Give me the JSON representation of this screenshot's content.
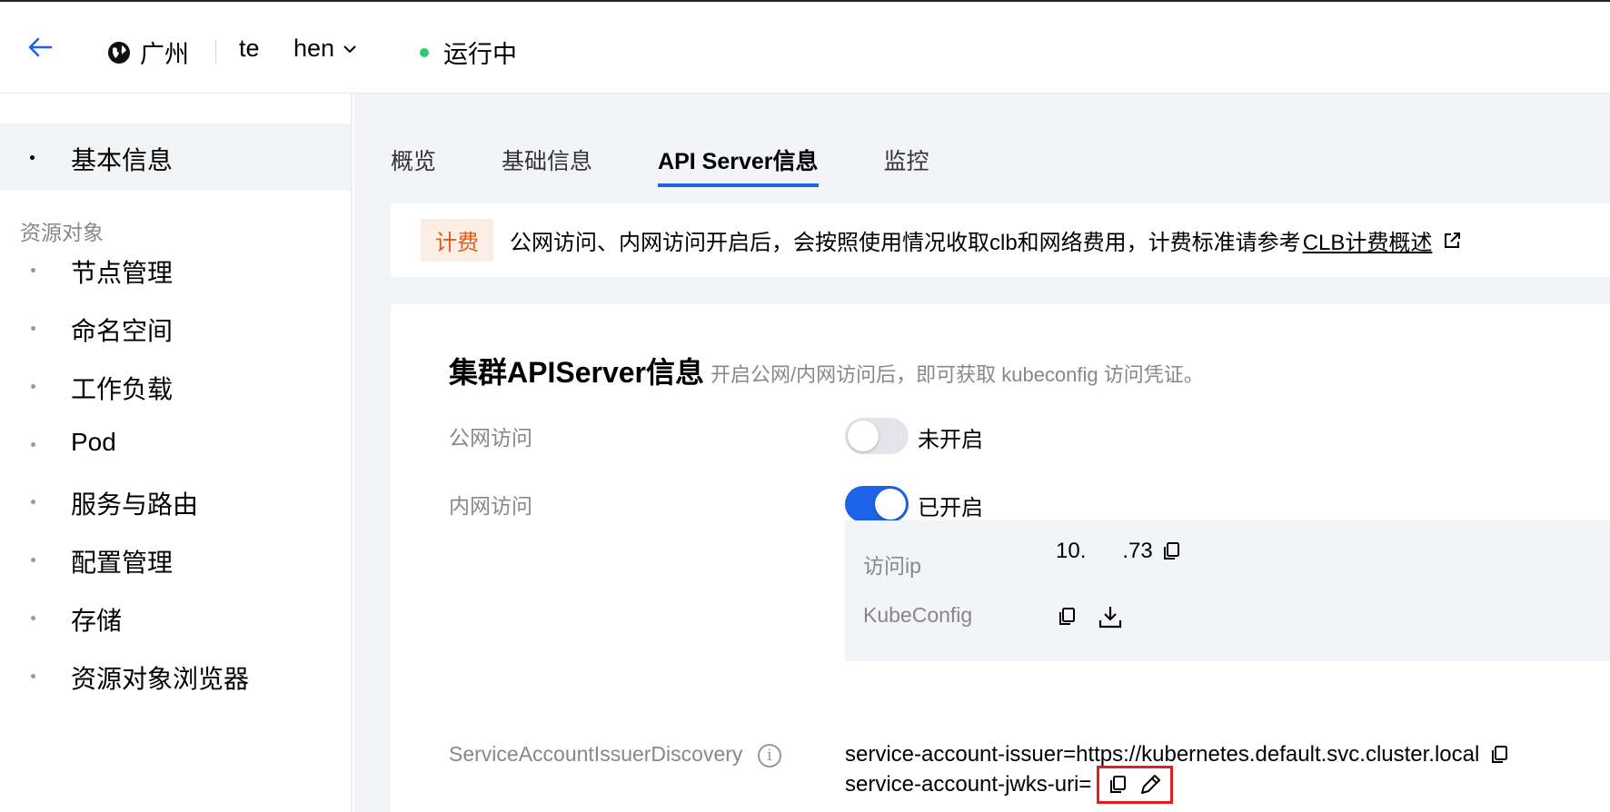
{
  "header": {
    "region": "广州",
    "cluster_name": "te     hen",
    "status": "运行中",
    "status_color": "#29cc6a"
  },
  "sidebar": {
    "active_item": "基本信息",
    "group_label": "资源对象",
    "items": [
      {
        "label": "节点管理"
      },
      {
        "label": "命名空间"
      },
      {
        "label": "工作负载"
      },
      {
        "label": "Pod"
      },
      {
        "label": "服务与路由"
      },
      {
        "label": "配置管理"
      },
      {
        "label": "存储"
      },
      {
        "label": "资源对象浏览器"
      }
    ]
  },
  "tabs": [
    {
      "label": "概览"
    },
    {
      "label": "基础信息"
    },
    {
      "label": "API Server信息",
      "active": true
    },
    {
      "label": "监控"
    }
  ],
  "notice": {
    "badge": "计费",
    "text": "公网访问、内网访问开启后，会按照使用情况收取clb和网络费用，计费标准请参考",
    "link": "CLB计费概述"
  },
  "card": {
    "title": "集群APIServer信息",
    "subtitle": "开启公网/内网访问后，即可获取 kubeconfig 访问凭证。",
    "public_access": {
      "label": "公网访问",
      "enabled": false,
      "state_text": "未开启"
    },
    "private_access": {
      "label": "内网访问",
      "enabled": true,
      "state_text": "已开启"
    },
    "access_ip": {
      "label": "访问ip",
      "value": "10.      .73"
    },
    "kubeconfig": {
      "label": "KubeConfig"
    },
    "sa_discovery": {
      "label": "ServiceAccountIssuerDiscovery",
      "issuer": "service-account-issuer=https://kubernetes.default.svc.cluster.local",
      "jwks": "service-account-jwks-uri="
    }
  },
  "colors": {
    "accent": "#1d63e8",
    "badge_bg": "#fdeee5",
    "badge_text": "#e35a1a",
    "highlight_box": "#e02020"
  },
  "icons": [
    "back-arrow-icon",
    "globe-icon",
    "chevron-down-icon",
    "external-link-icon",
    "copy-icon",
    "download-icon",
    "info-icon",
    "edit-icon"
  ]
}
